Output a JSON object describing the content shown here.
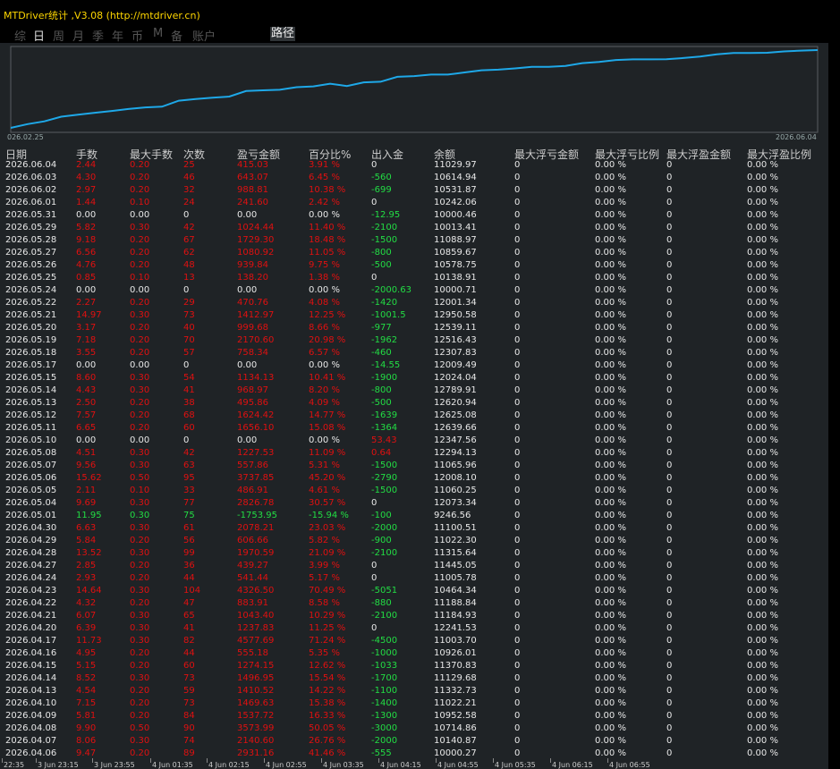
{
  "window": {
    "title": "MTDriver统计 ,V3.08 (http://mtdriver.cn)"
  },
  "tabs": [
    {
      "label": "综",
      "active": false
    },
    {
      "label": "日",
      "active": true
    },
    {
      "label": "周",
      "active": false
    },
    {
      "label": "月",
      "active": false
    },
    {
      "label": "季",
      "active": false
    },
    {
      "label": "年",
      "active": false
    },
    {
      "label": "币",
      "active": false
    },
    {
      "label": "M",
      "active": false
    },
    {
      "label": "备",
      "active": false
    },
    {
      "label": "账户",
      "active": false
    }
  ],
  "path_tab": "路径",
  "chart": {
    "start_label": "026.02.25",
    "end_label": "2026.06.04",
    "line_color": "#1ea8e8"
  },
  "columns": [
    "日期",
    "手数",
    "最大手数",
    "次数",
    "盈亏金额",
    "百分比%",
    "出入金",
    "余额",
    "最大浮亏金额",
    "最大浮亏比例",
    "最大浮盈金额",
    "最大浮盈比例"
  ],
  "rows": [
    [
      "2026.06.04",
      "2.44",
      "0.20",
      "25",
      "415.03",
      "3.91 %",
      "0",
      "11029.97",
      "0",
      "0.00 %",
      "0",
      "0.00 %"
    ],
    [
      "2026.06.03",
      "4.30",
      "0.20",
      "46",
      "643.07",
      "6.45 %",
      "-560",
      "10614.94",
      "0",
      "0.00 %",
      "0",
      "0.00 %"
    ],
    [
      "2026.06.02",
      "2.97",
      "0.20",
      "32",
      "988.81",
      "10.38 %",
      "-699",
      "10531.87",
      "0",
      "0.00 %",
      "0",
      "0.00 %"
    ],
    [
      "2026.06.01",
      "1.44",
      "0.10",
      "24",
      "241.60",
      "2.42 %",
      "0",
      "10242.06",
      "0",
      "0.00 %",
      "0",
      "0.00 %"
    ],
    [
      "2026.05.31",
      "0.00",
      "0.00",
      "0",
      "0.00",
      "0.00 %",
      "-12.95",
      "10000.46",
      "0",
      "0.00 %",
      "0",
      "0.00 %"
    ],
    [
      "2026.05.29",
      "5.82",
      "0.30",
      "42",
      "1024.44",
      "11.40 %",
      "-2100",
      "10013.41",
      "0",
      "0.00 %",
      "0",
      "0.00 %"
    ],
    [
      "2026.05.28",
      "9.18",
      "0.20",
      "67",
      "1729.30",
      "18.48 %",
      "-1500",
      "11088.97",
      "0",
      "0.00 %",
      "0",
      "0.00 %"
    ],
    [
      "2026.05.27",
      "6.56",
      "0.20",
      "62",
      "1080.92",
      "11.05 %",
      "-800",
      "10859.67",
      "0",
      "0.00 %",
      "0",
      "0.00 %"
    ],
    [
      "2026.05.26",
      "4.76",
      "0.20",
      "48",
      "939.84",
      "9.75 %",
      "-500",
      "10578.75",
      "0",
      "0.00 %",
      "0",
      "0.00 %"
    ],
    [
      "2026.05.25",
      "0.85",
      "0.10",
      "13",
      "138.20",
      "1.38 %",
      "0",
      "10138.91",
      "0",
      "0.00 %",
      "0",
      "0.00 %"
    ],
    [
      "2026.05.24",
      "0.00",
      "0.00",
      "0",
      "0.00",
      "0.00 %",
      "-2000.63",
      "10000.71",
      "0",
      "0.00 %",
      "0",
      "0.00 %"
    ],
    [
      "2026.05.22",
      "2.27",
      "0.20",
      "29",
      "470.76",
      "4.08 %",
      "-1420",
      "12001.34",
      "0",
      "0.00 %",
      "0",
      "0.00 %"
    ],
    [
      "2026.05.21",
      "14.97",
      "0.30",
      "73",
      "1412.97",
      "12.25 %",
      "-1001.5",
      "12950.58",
      "0",
      "0.00 %",
      "0",
      "0.00 %"
    ],
    [
      "2026.05.20",
      "3.17",
      "0.20",
      "40",
      "999.68",
      "8.66 %",
      "-977",
      "12539.11",
      "0",
      "0.00 %",
      "0",
      "0.00 %"
    ],
    [
      "2026.05.19",
      "7.18",
      "0.20",
      "70",
      "2170.60",
      "20.98 %",
      "-1962",
      "12516.43",
      "0",
      "0.00 %",
      "0",
      "0.00 %"
    ],
    [
      "2026.05.18",
      "3.55",
      "0.20",
      "57",
      "758.34",
      "6.57 %",
      "-460",
      "12307.83",
      "0",
      "0.00 %",
      "0",
      "0.00 %"
    ],
    [
      "2026.05.17",
      "0.00",
      "0.00",
      "0",
      "0.00",
      "0.00 %",
      "-14.55",
      "12009.49",
      "0",
      "0.00 %",
      "0",
      "0.00 %"
    ],
    [
      "2026.05.15",
      "8.60",
      "0.30",
      "54",
      "1134.13",
      "10.41 %",
      "-1900",
      "12024.04",
      "0",
      "0.00 %",
      "0",
      "0.00 %"
    ],
    [
      "2026.05.14",
      "4.43",
      "0.30",
      "41",
      "968.97",
      "8.20 %",
      "-800",
      "12789.91",
      "0",
      "0.00 %",
      "0",
      "0.00 %"
    ],
    [
      "2026.05.13",
      "2.50",
      "0.20",
      "38",
      "495.86",
      "4.09 %",
      "-500",
      "12620.94",
      "0",
      "0.00 %",
      "0",
      "0.00 %"
    ],
    [
      "2026.05.12",
      "7.57",
      "0.20",
      "68",
      "1624.42",
      "14.77 %",
      "-1639",
      "12625.08",
      "0",
      "0.00 %",
      "0",
      "0.00 %"
    ],
    [
      "2026.05.11",
      "6.65",
      "0.20",
      "60",
      "1656.10",
      "15.08 %",
      "-1364",
      "12639.66",
      "0",
      "0.00 %",
      "0",
      "0.00 %"
    ],
    [
      "2026.05.10",
      "0.00",
      "0.00",
      "0",
      "0.00",
      "0.00 %",
      "53.43",
      "12347.56",
      "0",
      "0.00 %",
      "0",
      "0.00 %"
    ],
    [
      "2026.05.08",
      "4.51",
      "0.30",
      "42",
      "1227.53",
      "11.09 %",
      "0.64",
      "12294.13",
      "0",
      "0.00 %",
      "0",
      "0.00 %"
    ],
    [
      "2026.05.07",
      "9.56",
      "0.30",
      "63",
      "557.86",
      "5.31 %",
      "-1500",
      "11065.96",
      "0",
      "0.00 %",
      "0",
      "0.00 %"
    ],
    [
      "2026.05.06",
      "15.62",
      "0.50",
      "95",
      "3737.85",
      "45.20 %",
      "-2790",
      "12008.10",
      "0",
      "0.00 %",
      "0",
      "0.00 %"
    ],
    [
      "2026.05.05",
      "2.11",
      "0.10",
      "33",
      "486.91",
      "4.61 %",
      "-1500",
      "11060.25",
      "0",
      "0.00 %",
      "0",
      "0.00 %"
    ],
    [
      "2026.05.04",
      "9.69",
      "0.30",
      "77",
      "2826.78",
      "30.57 %",
      "0",
      "12073.34",
      "0",
      "0.00 %",
      "0",
      "0.00 %"
    ],
    [
      "2026.05.01",
      "11.95",
      "0.30",
      "75",
      "-1753.95",
      "-15.94 %",
      "-100",
      "9246.56",
      "0",
      "0.00 %",
      "0",
      "0.00 %"
    ],
    [
      "2026.04.30",
      "6.63",
      "0.30",
      "61",
      "2078.21",
      "23.03 %",
      "-2000",
      "11100.51",
      "0",
      "0.00 %",
      "0",
      "0.00 %"
    ],
    [
      "2026.04.29",
      "5.84",
      "0.20",
      "56",
      "606.66",
      "5.82 %",
      "-900",
      "11022.30",
      "0",
      "0.00 %",
      "0",
      "0.00 %"
    ],
    [
      "2026.04.28",
      "13.52",
      "0.30",
      "99",
      "1970.59",
      "21.09 %",
      "-2100",
      "11315.64",
      "0",
      "0.00 %",
      "0",
      "0.00 %"
    ],
    [
      "2026.04.27",
      "2.85",
      "0.20",
      "36",
      "439.27",
      "3.99 %",
      "0",
      "11445.05",
      "0",
      "0.00 %",
      "0",
      "0.00 %"
    ],
    [
      "2026.04.24",
      "2.93",
      "0.20",
      "44",
      "541.44",
      "5.17 %",
      "0",
      "11005.78",
      "0",
      "0.00 %",
      "0",
      "0.00 %"
    ],
    [
      "2026.04.23",
      "14.64",
      "0.30",
      "104",
      "4326.50",
      "70.49 %",
      "-5051",
      "10464.34",
      "0",
      "0.00 %",
      "0",
      "0.00 %"
    ],
    [
      "2026.04.22",
      "4.32",
      "0.20",
      "47",
      "883.91",
      "8.58 %",
      "-880",
      "11188.84",
      "0",
      "0.00 %",
      "0",
      "0.00 %"
    ],
    [
      "2026.04.21",
      "6.07",
      "0.30",
      "65",
      "1043.40",
      "10.29 %",
      "-2100",
      "11184.93",
      "0",
      "0.00 %",
      "0",
      "0.00 %"
    ],
    [
      "2026.04.20",
      "6.39",
      "0.30",
      "41",
      "1237.83",
      "11.25 %",
      "0",
      "12241.53",
      "0",
      "0.00 %",
      "0",
      "0.00 %"
    ],
    [
      "2026.04.17",
      "11.73",
      "0.30",
      "82",
      "4577.69",
      "71.24 %",
      "-4500",
      "11003.70",
      "0",
      "0.00 %",
      "0",
      "0.00 %"
    ],
    [
      "2026.04.16",
      "4.95",
      "0.20",
      "44",
      "555.18",
      "5.35 %",
      "-1000",
      "10926.01",
      "0",
      "0.00 %",
      "0",
      "0.00 %"
    ],
    [
      "2026.04.15",
      "5.15",
      "0.20",
      "60",
      "1274.15",
      "12.62 %",
      "-1033",
      "11370.83",
      "0",
      "0.00 %",
      "0",
      "0.00 %"
    ],
    [
      "2026.04.14",
      "8.52",
      "0.30",
      "73",
      "1496.95",
      "15.54 %",
      "-1700",
      "11129.68",
      "0",
      "0.00 %",
      "0",
      "0.00 %"
    ],
    [
      "2026.04.13",
      "4.54",
      "0.20",
      "59",
      "1410.52",
      "14.22 %",
      "-1100",
      "11332.73",
      "0",
      "0.00 %",
      "0",
      "0.00 %"
    ],
    [
      "2026.04.10",
      "7.15",
      "0.20",
      "73",
      "1469.63",
      "15.38 %",
      "-1400",
      "11022.21",
      "0",
      "0.00 %",
      "0",
      "0.00 %"
    ],
    [
      "2026.04.09",
      "5.81",
      "0.20",
      "84",
      "1537.72",
      "16.33 %",
      "-1300",
      "10952.58",
      "0",
      "0.00 %",
      "0",
      "0.00 %"
    ],
    [
      "2026.04.08",
      "9.90",
      "0.50",
      "90",
      "3573.99",
      "50.05 %",
      "-3000",
      "10714.86",
      "0",
      "0.00 %",
      "0",
      "0.00 %"
    ],
    [
      "2026.04.07",
      "8.06",
      "0.30",
      "74",
      "2140.60",
      "26.76 %",
      "-2000",
      "10140.87",
      "0",
      "0.00 %",
      "0",
      "0.00 %"
    ],
    [
      "2026.04.06",
      "9.47",
      "0.20",
      "89",
      "2931.16",
      "41.46 %",
      "-555",
      "10000.27",
      "0",
      "0.00 %",
      "0",
      "0.00 %"
    ]
  ],
  "time_axis": [
    "22:35",
    "3 Jun 23:15",
    "3 Jun 23:55",
    "4 Jun 01:35",
    "4 Jun 02:15",
    "4 Jun 02:55",
    "4 Jun 03:35",
    "4 Jun 04:15",
    "4 Jun 04:55",
    "4 Jun 05:35",
    "4 Jun 06:15",
    "4 Jun 06:55"
  ],
  "colors": {
    "background": "#1f2326",
    "title": "#ffd700",
    "profit": "#e01010",
    "loss": "#22dd44",
    "neutral": "#e8e8e8",
    "equity_line": "#1ea8e8"
  }
}
